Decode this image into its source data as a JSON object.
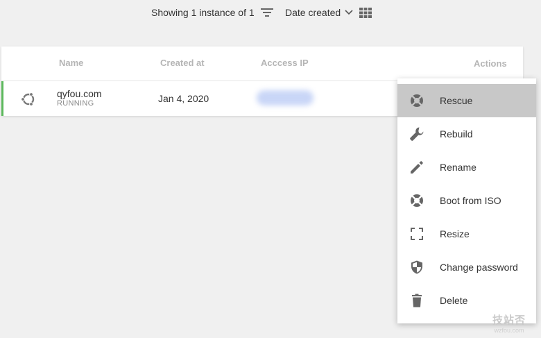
{
  "toolbar": {
    "showing_text": "Showing 1 instance of 1",
    "sort_label": "Date created",
    "filter_icon": "filter-icon",
    "grid_icon": "grid-view-icon"
  },
  "table": {
    "headers": {
      "name": "Name",
      "created": "Created at",
      "ip": "Acccess IP",
      "actions": "Actions"
    },
    "rows": [
      {
        "icon": "ubuntu-icon",
        "name": "qyfou.com",
        "status": "RUNNING",
        "created": "Jan 4, 2020",
        "status_color": "#5cb85c"
      }
    ]
  },
  "menu": {
    "items": [
      {
        "label": "Rescue",
        "icon": "lifebuoy-icon",
        "active": true
      },
      {
        "label": "Rebuild",
        "icon": "wrench-icon"
      },
      {
        "label": "Rename",
        "icon": "pencil-icon"
      },
      {
        "label": "Boot from ISO",
        "icon": "lifebuoy-icon"
      },
      {
        "label": "Resize",
        "icon": "resize-icon"
      },
      {
        "label": "Change password",
        "icon": "shield-icon"
      },
      {
        "label": "Delete",
        "icon": "trash-icon"
      }
    ]
  },
  "watermark": {
    "logo": "技站否",
    "site": "wzfou.com"
  }
}
